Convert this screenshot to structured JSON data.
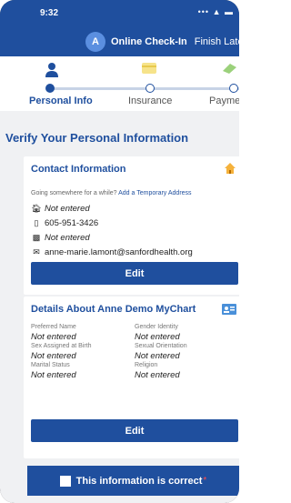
{
  "status": {
    "time": "9:32",
    "signal": "••• ▲ ▬"
  },
  "header": {
    "logo_letter": "A",
    "title": "Online Check-In",
    "finish_label": "Finish Later"
  },
  "steps": [
    {
      "label": "Personal Info",
      "icon": "person-icon",
      "state": "active"
    },
    {
      "label": "Insurance",
      "icon": "card-icon",
      "state": "upcoming"
    },
    {
      "label": "Payme",
      "icon": "money-icon",
      "state": "upcoming"
    }
  ],
  "page_title": "Verify Your Personal Information",
  "contact": {
    "title": "Contact Information",
    "temp_question": "Going somewhere for a while?",
    "temp_link": "Add a Temporary Address",
    "home_address": "Not entered",
    "mobile_phone": "605-951-3426",
    "work_phone": "Not entered",
    "email": "anne-marie.lamont@sanfordhealth.org",
    "edit_label": "Edit"
  },
  "details": {
    "title": "Details About Anne Demo MyChart",
    "fields": [
      {
        "label": "Preferred Name",
        "value": "Not entered"
      },
      {
        "label": "Gender Identity",
        "value": "Not entered"
      },
      {
        "label": "Sex Assigned at Birth",
        "value": "Not entered"
      },
      {
        "label": "Sexual Orientation",
        "value": "Not entered"
      },
      {
        "label": "Marital Status",
        "value": "Not entered"
      },
      {
        "label": "Religion",
        "value": "Not entered"
      }
    ],
    "edit_label": "Edit"
  },
  "confirm": {
    "label": "This information is correct",
    "required_marker": "*"
  },
  "colors": {
    "primary": "#1f4f9e",
    "background": "#f0f1f3",
    "accent": "#f5b23c",
    "required": "#ff4b4b"
  }
}
